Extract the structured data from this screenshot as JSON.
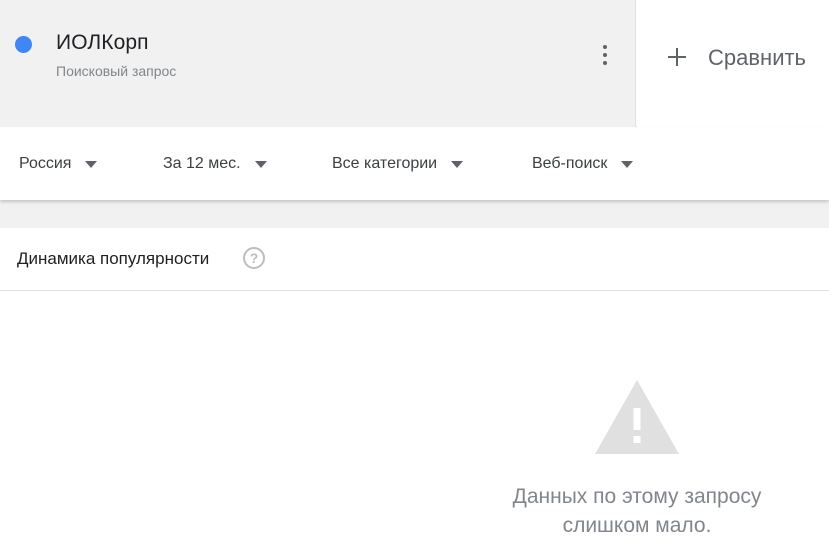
{
  "term": {
    "name": "ИОЛКорп",
    "type": "Поисковый запрос",
    "color": "#4285f4"
  },
  "compare": {
    "label": "Сравнить"
  },
  "filters": {
    "region": "Россия",
    "period": "За 12 мес.",
    "category": "Все категории",
    "search_type": "Веб-поиск"
  },
  "section": {
    "title": "Динамика популярности",
    "help_glyph": "?"
  },
  "empty_state": {
    "message_line1": "Данных по этому запросу",
    "message_line2": "слишком мало."
  },
  "icons": {
    "menu": "more-vert-icon",
    "compare": "plus-icon",
    "dropdown": "triangle-down-icon",
    "help": "question-circle-icon",
    "warning": "warning-triangle-icon"
  }
}
